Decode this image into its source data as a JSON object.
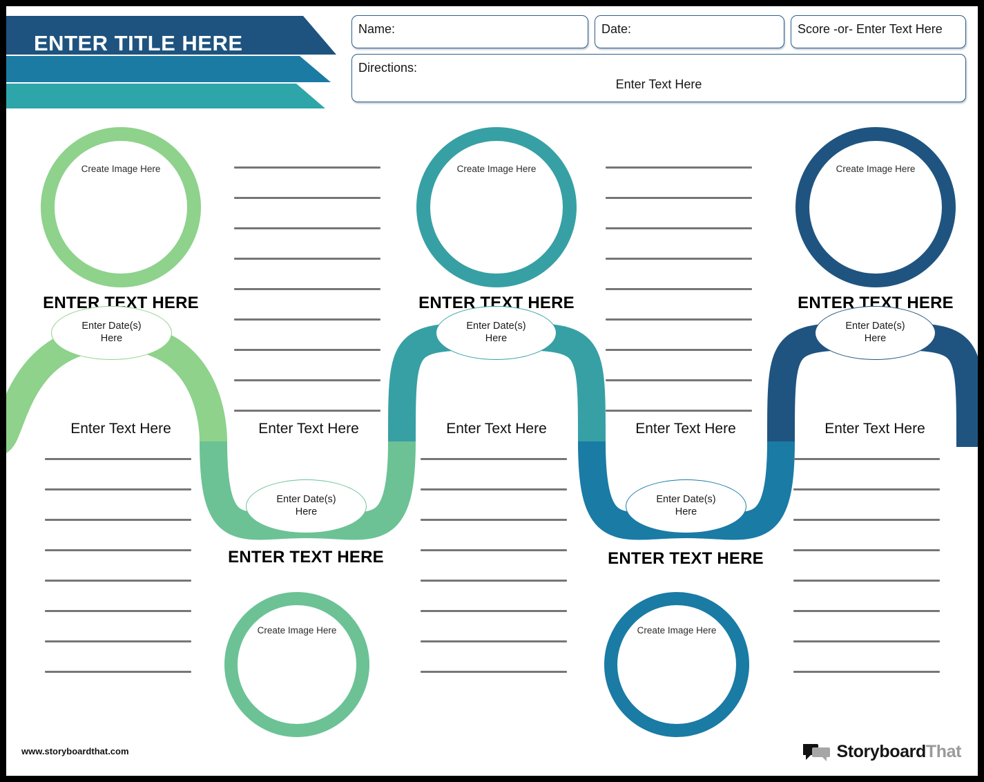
{
  "header": {
    "title": "ENTER TITLE HERE",
    "fields": [
      {
        "name": "name-field",
        "label": "Name:"
      },
      {
        "name": "date-field",
        "label": "Date:"
      },
      {
        "name": "score-field",
        "label": "Score -or- Enter Text Here"
      }
    ],
    "directions": {
      "label": "Directions:",
      "value": "Enter Text Here"
    }
  },
  "colors": {
    "banner_dark": "#1e5380",
    "banner_mid": "#1c7ba3",
    "banner_light": "#2ea5a8",
    "field_border": "#2e5f8a",
    "green_light": "#8ed28c",
    "green_mid": "#6cc295",
    "teal": "#37a0a4",
    "blue_mid": "#1a7ba5",
    "navy": "#1f5480",
    "rule": "#767676"
  },
  "image_circles": [
    {
      "name": "image-circle-1",
      "caption": "Create Image Here",
      "color": "#8ed28c"
    },
    {
      "name": "image-circle-2",
      "caption": "Create Image Here",
      "color": "#37a0a4"
    },
    {
      "name": "image-circle-3",
      "caption": "Create Image Here",
      "color": "#1f5480"
    },
    {
      "name": "image-circle-4",
      "caption": "Create Image Here",
      "color": "#6cc295"
    },
    {
      "name": "image-circle-5",
      "caption": "Create Image Here",
      "color": "#1a7ba5"
    }
  ],
  "bold_labels": [
    {
      "name": "event-title-1",
      "text": "ENTER TEXT HERE"
    },
    {
      "name": "event-title-2",
      "text": "ENTER TEXT HERE"
    },
    {
      "name": "event-title-3",
      "text": "ENTER TEXT HERE"
    },
    {
      "name": "event-title-4",
      "text": "ENTER TEXT HERE"
    },
    {
      "name": "event-title-5",
      "text": "ENTER TEXT HERE"
    }
  ],
  "mid_labels": [
    {
      "name": "step-label-1",
      "text": "Enter Text Here"
    },
    {
      "name": "step-label-2",
      "text": "Enter Text Here"
    },
    {
      "name": "step-label-3",
      "text": "Enter Text Here"
    },
    {
      "name": "step-label-4",
      "text": "Enter Text Here"
    },
    {
      "name": "step-label-5",
      "text": "Enter Text Here"
    }
  ],
  "date_ovals": [
    {
      "name": "date-oval-1",
      "line1": "Enter Date(s)",
      "line2": "Here",
      "color": "#8ed28c"
    },
    {
      "name": "date-oval-2",
      "line1": "Enter Date(s)",
      "line2": "Here",
      "color": "#6cc295"
    },
    {
      "name": "date-oval-3",
      "line1": "Enter Date(s)",
      "line2": "Here",
      "color": "#37a0a4"
    },
    {
      "name": "date-oval-4",
      "line1": "Enter Date(s)",
      "line2": "Here",
      "color": "#1a7ba5"
    },
    {
      "name": "date-oval-5",
      "line1": "Enter Date(s)",
      "line2": "Here",
      "color": "#1f5480"
    }
  ],
  "line_groups": [
    {
      "name": "writing-lines-col2-top",
      "count": 9
    },
    {
      "name": "writing-lines-col4-top",
      "count": 9
    },
    {
      "name": "writing-lines-col1-bottom",
      "count": 8
    },
    {
      "name": "writing-lines-col3-bottom",
      "count": 8
    },
    {
      "name": "writing-lines-col5-bottom",
      "count": 8
    }
  ],
  "footer": {
    "url": "www.storyboardthat.com",
    "logo_bold": "Storyboard",
    "logo_light": "That"
  }
}
